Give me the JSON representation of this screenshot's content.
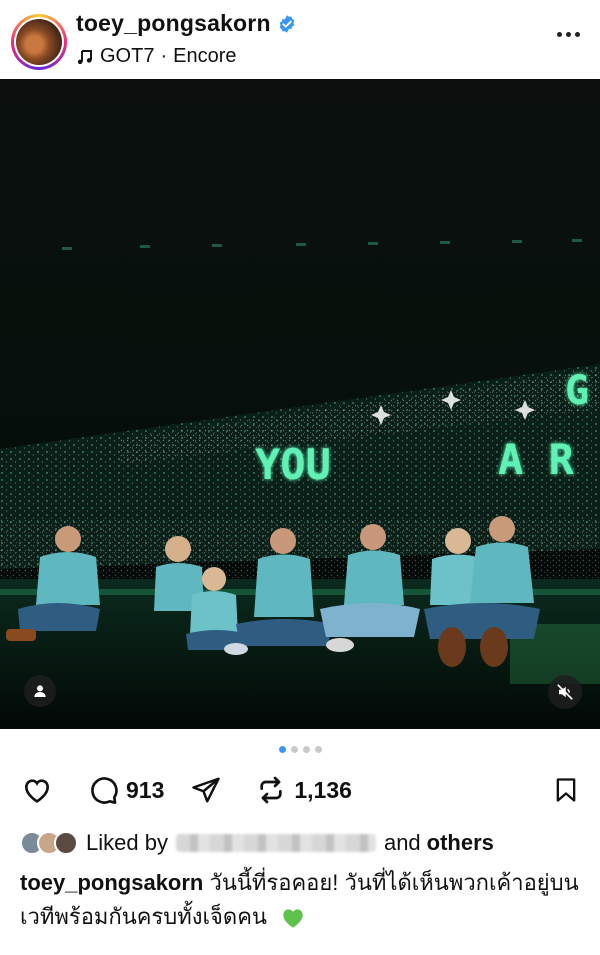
{
  "post": {
    "username": "toey_pongsakorn",
    "verified": true,
    "music": {
      "artist": "GOT7",
      "separator": "·",
      "track": "Encore"
    }
  },
  "photo": {
    "sign_text_upper": "G",
    "sign_text": "YOU",
    "sign_text_right": "A R",
    "carousel_slides": 4,
    "carousel_active_index": 0
  },
  "actions": {
    "comments_count": "913",
    "reposts_count": "1,136"
  },
  "liked_by": {
    "prefix": "Liked by",
    "connector": "and",
    "suffix": "others"
  },
  "caption": {
    "username": "toey_pongsakorn",
    "text": "วันนี้ที่รอคอย! วันที่ได้เห็นพวกเค้าอยู่บนเวทีพร้อมกันครบทั้งเจ็ดคน",
    "emoji": "green-heart"
  },
  "colors": {
    "verified_blue": "#3897f0",
    "led_green": "#5ff2b4",
    "jersey_teal": "#5fb8c0",
    "green_heart": "#5ec34a"
  }
}
